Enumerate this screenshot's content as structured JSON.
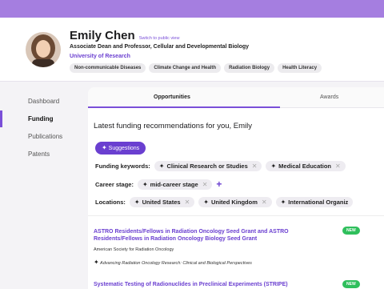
{
  "profile": {
    "name": "Emily Chen",
    "switch_link": "Switch to public view",
    "role": "Associate Dean and Professor, Cellular and Developmental Biology",
    "university": "University of Research",
    "tags": [
      "Non-communicable Diseases",
      "Climate Change and Health",
      "Radiation Biology",
      "Health Literacy"
    ]
  },
  "sidenav": {
    "items": [
      "Dashboard",
      "Funding",
      "Publications",
      "Patents"
    ],
    "active": "Funding"
  },
  "tabs": {
    "opportunities": "Opportunities",
    "awards": "Awards"
  },
  "main": {
    "heading": "Latest funding recommendations for you, Emily",
    "suggestions_label": "Suggestions",
    "keywords_label": "Funding keywords:",
    "keywords": [
      "Clinical Research or Studies",
      "Medical Education"
    ],
    "career_label": "Career stage:",
    "career": [
      "mid-career stage"
    ],
    "locations_label": "Locations:",
    "locations": [
      "United States",
      "United Kingdom",
      "International Organiz"
    ]
  },
  "results": [
    {
      "title": "ASTRO Residents/Fellows in Radiation Oncology Seed Grant and ASTRO Residents/Fellows in Radiation Oncology Biology Seed Grant",
      "badge": "NEW",
      "org": "American Society for Radiation Oncology",
      "keywords": "Advancing Radiation Oncology Research: Clinical and Biological Perspectives"
    },
    {
      "title": "Systematic Testing of Radionuclides in Preclinical Experiments (STRIPE)",
      "badge": "NEW"
    }
  ],
  "colors": {
    "accent": "#7a4fd8",
    "topbar": "#a57ee0",
    "new_badge": "#2fbf5c"
  }
}
